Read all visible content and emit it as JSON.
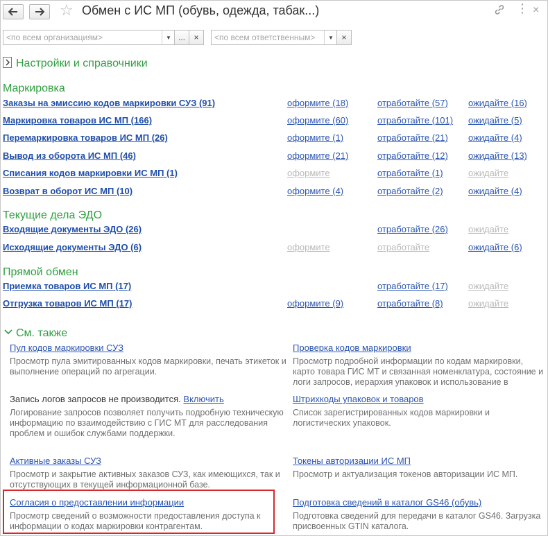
{
  "window": {
    "title": "Обмен с ИС МП (обувь, одежда, табак...)",
    "icons": [
      "back-arrow-icon",
      "forward-arrow-icon",
      "star-icon",
      "link-icon",
      "more-icon",
      "close-icon"
    ]
  },
  "filters": {
    "org_placeholder": "<по всем организациям>",
    "more_label": "...",
    "clear_label": "×",
    "resp_placeholder": "<по всем ответственным>"
  },
  "settings_group": {
    "label": "Настройки и справочники"
  },
  "marking": {
    "heading": "Маркировка",
    "rows": [
      {
        "label": "Заказы на эмиссию кодов маркировки СУЗ (91)",
        "c1": "оформите (18)",
        "c2": "отработайте (57)",
        "c3": "ожидайте (16)"
      },
      {
        "label": "Маркировка товаров ИС МП (166)",
        "c1": "оформите (60)",
        "c2": "отработайте (101)",
        "c3": "ожидайте (5)"
      },
      {
        "label": "Перемаркировка товаров ИС МП (26)",
        "c1": "оформите (1)",
        "c2": "отработайте (21)",
        "c3": "ожидайте (4)"
      },
      {
        "label": "Вывод из оборота ИС МП (46)",
        "c1": "оформите (21)",
        "c2": "отработайте (12)",
        "c3": "ожидайте (13)"
      },
      {
        "label": "Списания кодов маркировки ИС МП (1)",
        "c1": "оформите",
        "c2": "отработайте (1)",
        "c3": "ожидайте"
      },
      {
        "label": "Возврат в оборот ИС МП (10)",
        "c1": "оформите (4)",
        "c2": "отработайте (2)",
        "c3": "ожидайте (4)"
      }
    ]
  },
  "edo": {
    "heading": "Текущие дела ЭДО",
    "rows": [
      {
        "label": "Входящие документы ЭДО (26)",
        "c1": "",
        "c2": "отработайте (26)",
        "c3": "ожидайте"
      },
      {
        "label": "Исходящие документы ЭДО (6)",
        "c1": "оформите",
        "c2": "отработайте",
        "c3": "ожидайте (6)"
      }
    ]
  },
  "direct": {
    "heading": "Прямой обмен",
    "rows": [
      {
        "label": "Приемка товаров ИС МП (17)",
        "c1": "",
        "c2": "отработайте (17)",
        "c3": "ожидайте"
      },
      {
        "label": "Отгрузка товаров ИС МП (17)",
        "c1": "оформите (9)",
        "c2": "отработайте (8)",
        "c3": "ожидайте"
      }
    ]
  },
  "see_also": {
    "heading": "См. также",
    "items": [
      {
        "title": "Пул кодов маркировки СУЗ",
        "desc": "Просмотр пула эмитированных кодов маркировки, печать этикеток и выполнение операций по агрегации."
      },
      {
        "title": "Проверка кодов маркировки",
        "desc": "Просмотр подробной информации по кодам маркировки, карто товара ГИС МТ и связанная номенклатура, состояние и логи запросов, иерархия упаковок и использование в документах."
      },
      {
        "prefix": "Запись логов запросов не производится.",
        "title": "Включить",
        "desc": "Логирование запросов позволяет получить подробную техническую информацию по взаимодействию с ГИС МТ для расследования проблем и ошибок службами поддержки."
      },
      {
        "title": "Штрихкоды упаковок и товаров",
        "desc": "Список зарегистрированных кодов маркировки и логистических упаковок."
      },
      {
        "title": "Активные заказы СУЗ",
        "desc": "Просмотр и закрытие активных заказов СУЗ, как имеющихся, так и отсутствующих в текущей информационной базе."
      },
      {
        "title": "Токены авторизации ИС МП",
        "desc": "Просмотр и актуализация токенов авторизации ИС МП."
      },
      {
        "title": "Согласия о предоставлении информации",
        "desc": "Просмотр сведений о возможности предоставления доступа к информации о кодах маркировки контрагентам."
      },
      {
        "title": "Подготовка сведений в каталог GS46 (обувь)",
        "desc": "Подготовка сведений для передачи в каталог GS46. Загрузка присвоенных GTIN каталога."
      }
    ]
  },
  "colors": {
    "link": "#1f4ea8",
    "heading_green": "#2f9f3f",
    "disabled": "#b9b9b9",
    "highlight": "#d9262a"
  }
}
